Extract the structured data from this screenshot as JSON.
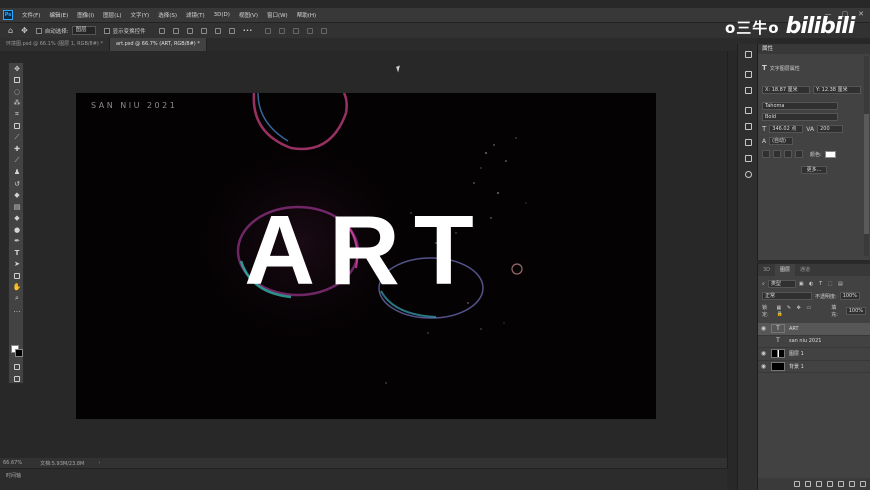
{
  "app": {
    "logo": "Ps"
  },
  "menu": [
    "文件(F)",
    "编辑(E)",
    "图像(I)",
    "图层(L)",
    "文字(Y)",
    "选择(S)",
    "滤镜(T)",
    "3D(D)",
    "视图(V)",
    "窗口(W)",
    "帮助(H)"
  ],
  "window_controls": [
    "—",
    "▢",
    "✕"
  ],
  "options_bar": {
    "auto_select_label": "自动选择:",
    "auto_select_value": "图层",
    "show_transform_label": "显示变换控件",
    "more": "•••"
  },
  "tabs": [
    {
      "label": "环境图.psd @ 66.1% (图层 1, RGB/8#) *",
      "active": false
    },
    {
      "label": "art.psd @ 66.7% (ART, RGB/8#) *",
      "active": true
    }
  ],
  "document": {
    "caption": "SAN NIU 2021",
    "headline": "ART"
  },
  "status": {
    "zoom": "66.67%",
    "doc": "文档:5.93M/23.8M"
  },
  "timeline": {
    "label": "时间轴"
  },
  "watermark": {
    "name": "o三牛o",
    "logo": "bilibili"
  },
  "properties": {
    "panel_title": "属性",
    "section": "文字图层属性",
    "x": "X: 18.87 厘米",
    "y": "Y: 12.38 厘米",
    "font": "Tahoma",
    "style": "Bold",
    "size": "346.02 点",
    "tracking": "200",
    "leading": "(自动)",
    "color_label": "颜色:",
    "more_btn": "更多..."
  },
  "layers_panel": {
    "tabs": [
      "3D",
      "图层",
      "通道"
    ],
    "filter": "类型",
    "blend": "正常",
    "opacity_label": "不透明度:",
    "opacity": "100%",
    "lock_label": "锁定:",
    "fill_label": "填充:",
    "fill": "100%",
    "layers": [
      {
        "name": "ART",
        "kind": "T",
        "selected": true
      },
      {
        "name": "san niu 2021",
        "kind": "T",
        "selected": false
      },
      {
        "name": "图层 1",
        "kind": "img",
        "selected": false
      },
      {
        "name": "背景 1",
        "kind": "bg",
        "selected": false
      }
    ]
  }
}
